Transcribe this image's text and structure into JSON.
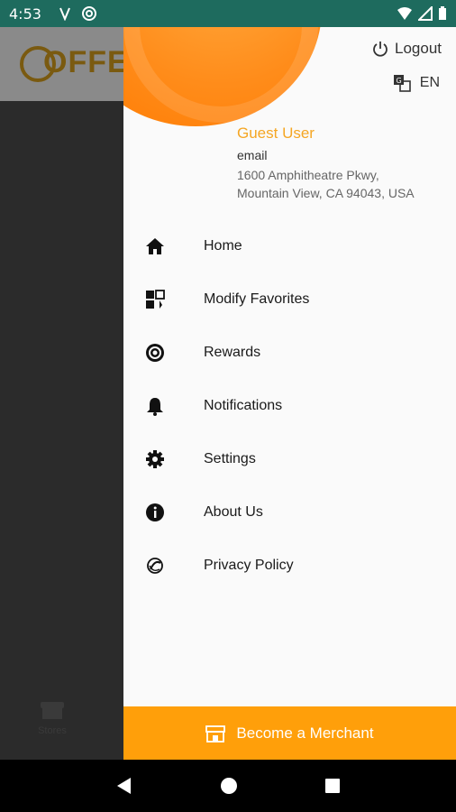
{
  "status_bar": {
    "time": "4:53"
  },
  "background_app": {
    "logo_text": "OFFERS",
    "bottom_tab_label": "Stores"
  },
  "drawer": {
    "logout_label": "Logout",
    "language_label": "EN",
    "user": {
      "name": "Guest User",
      "email": "email",
      "address_line1": "1600 Amphitheatre Pkwy,",
      "address_line2": "Mountain View, CA 94043, USA"
    },
    "menu": [
      {
        "label": "Home",
        "icon": "home-icon"
      },
      {
        "label": "Modify Favorites",
        "icon": "favorites-icon"
      },
      {
        "label": "Rewards",
        "icon": "rewards-icon"
      },
      {
        "label": "Notifications",
        "icon": "bell-icon"
      },
      {
        "label": "Settings",
        "icon": "gear-icon"
      },
      {
        "label": "About Us",
        "icon": "info-icon"
      },
      {
        "label": "Privacy Policy",
        "icon": "privacy-icon"
      }
    ],
    "merchant_label": "Become a Merchant"
  },
  "colors": {
    "accent_orange": "#ff9f0a",
    "guest_name": "#f5a623",
    "status_bar": "#1e6b5e"
  }
}
